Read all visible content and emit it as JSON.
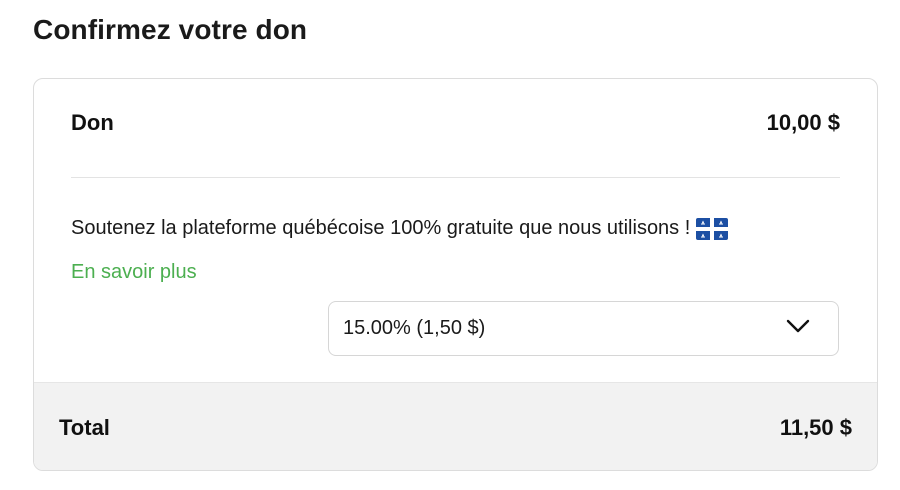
{
  "page": {
    "title": "Confirmez votre don"
  },
  "donation": {
    "label": "Don",
    "amount": "10,00 $"
  },
  "support": {
    "text": "Soutenez la plateforme québécoise 100% gratuite que nous utilisons !",
    "flag_icon": "quebec-flag-icon",
    "learn_more_label": "En savoir plus",
    "learn_more_color": "#4caf50"
  },
  "tip_select": {
    "selected_value": "15.00% (1,50 $)",
    "icon": "chevron-down-icon"
  },
  "total": {
    "label": "Total",
    "amount": "11,50 $"
  },
  "colors": {
    "quebec_blue": "#1c4fa3",
    "total_bar_bg": "#f2f2f2"
  }
}
